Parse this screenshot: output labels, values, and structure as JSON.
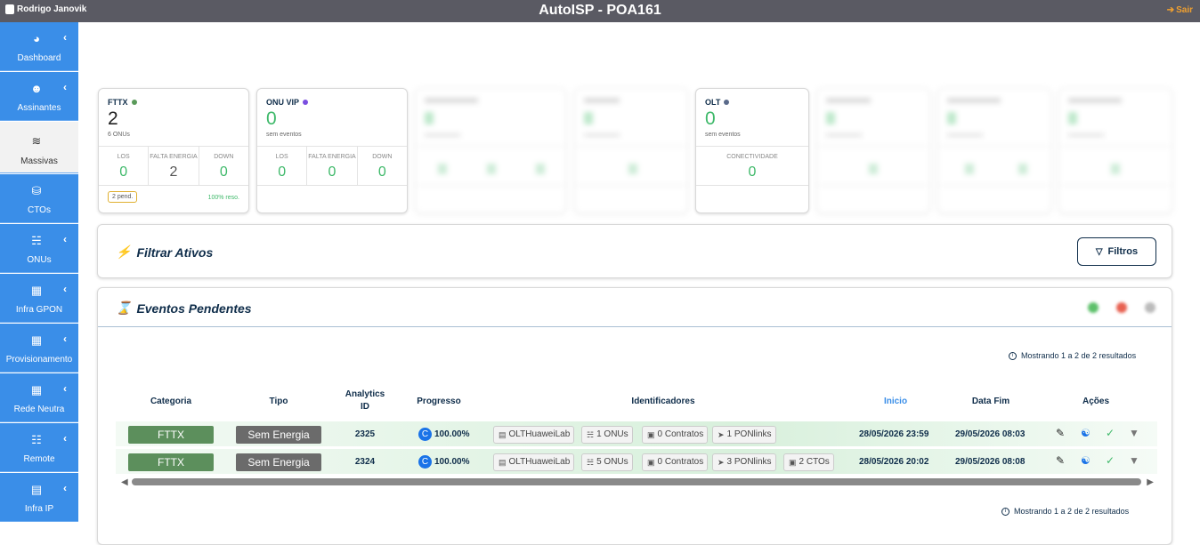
{
  "topbar": {
    "user": "Rodrigo Janovik",
    "title": "AutoISP - POA161",
    "logout": "Sair"
  },
  "sidebar": {
    "items": [
      {
        "label": "Dashboard",
        "icon": "gauge-icon",
        "has_chevron": true
      },
      {
        "label": "Assinantes",
        "icon": "user-icon",
        "has_chevron": true
      },
      {
        "label": "Massivas",
        "icon": "wifi-off-icon",
        "has_chevron": false,
        "active": true
      },
      {
        "label": "CTOs",
        "icon": "database-icon",
        "has_chevron": false
      },
      {
        "label": "ONUs",
        "icon": "sitemap-icon",
        "has_chevron": true
      },
      {
        "label": "Infra GPON",
        "icon": "building-icon",
        "has_chevron": true
      },
      {
        "label": "Provisionamento",
        "icon": "building-icon",
        "has_chevron": true
      },
      {
        "label": "Rede Neutra",
        "icon": "building-icon",
        "has_chevron": true
      },
      {
        "label": "Remote",
        "icon": "router-icon",
        "has_chevron": true
      },
      {
        "label": "Infra IP",
        "icon": "server-icon",
        "has_chevron": true
      }
    ]
  },
  "stats": {
    "fttx": {
      "title": "FTTX",
      "dot_color": "#5a9a5a",
      "value": "2",
      "sub": "6 ONUs",
      "metrics": [
        {
          "label": "LOS",
          "value": "0"
        },
        {
          "label": "FALTA ENERGIA",
          "value": "2"
        },
        {
          "label": "DOWN",
          "value": "0"
        }
      ],
      "pending": "2 pend.",
      "resolved": "100% reso."
    },
    "onu_vip": {
      "title": "ONU VIP",
      "dot_color": "#7a4ee0",
      "value": "0",
      "sub": "sem eventos",
      "metrics": [
        {
          "label": "LOS",
          "value": "0"
        },
        {
          "label": "FALTA ENERGIA",
          "value": "0"
        },
        {
          "label": "DOWN",
          "value": "0"
        }
      ]
    },
    "olt": {
      "title": "OLT",
      "dot_color": "#5a6a8a",
      "value": "0",
      "sub": "sem eventos",
      "metrics": [
        {
          "label": "CONECTIVIDADE",
          "value": "0"
        }
      ]
    }
  },
  "filter": {
    "title": "Filtrar Ativos",
    "button": "Filtros"
  },
  "events": {
    "title": "Eventos Pendentes",
    "showing_top": "Mostrando 1 a 2 de 2 resultados",
    "showing_bottom": "Mostrando 1 a 2 de 2 resultados",
    "columns": {
      "categoria": "Categoria",
      "tipo": "Tipo",
      "analytics_l1": "Analytics",
      "analytics_l2": "ID",
      "progresso": "Progresso",
      "identificadores": "Identificadores",
      "inicio": "Inicio",
      "data_fim": "Data Fim",
      "acoes": "Ações"
    },
    "rows": [
      {
        "categoria": "FTTX",
        "tipo": "Sem Energia",
        "analytics_id": "2325",
        "progress_letter": "C",
        "progresso": "100.00%",
        "chips": [
          "OLTHuaweiLab",
          "1 ONUs",
          "0 Contratos",
          "1 PONlinks"
        ],
        "inicio": "28/05/2026 23:59",
        "data_fim": "29/05/2026 08:03"
      },
      {
        "categoria": "FTTX",
        "tipo": "Sem Energia",
        "analytics_id": "2324",
        "progress_letter": "C",
        "progresso": "100.00%",
        "chips": [
          "OLTHuaweiLab",
          "5 ONUs",
          "0 Contratos",
          "3 PONlinks",
          "2 CTOs"
        ],
        "inicio": "28/05/2026 20:02",
        "data_fim": "29/05/2026 08:08"
      }
    ]
  },
  "colors": {
    "sidebar": "#3a8ee8",
    "navy": "#0f2d4a",
    "green": "#3fb96a",
    "topbar": "#5a5a63"
  }
}
